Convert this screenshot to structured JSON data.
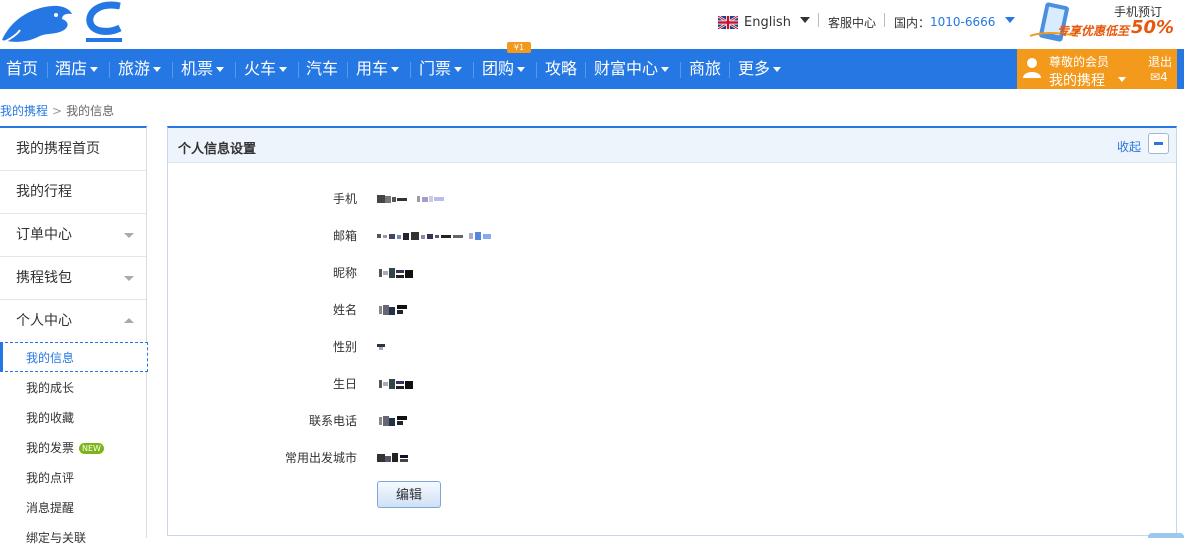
{
  "topbar": {
    "language": "English",
    "service_center": "客服中心",
    "domestic_label": "国内：",
    "phone": "1010-6666",
    "promo_title": "手机预订",
    "promo_sub": "专享优惠低至",
    "promo_pct": "50%"
  },
  "nav": {
    "items": [
      "首页",
      "酒店",
      "旅游",
      "机票",
      "火车",
      "汽车",
      "用车",
      "门票",
      "团购",
      "攻略",
      "财富中心",
      "商旅",
      "更多"
    ],
    "groupbuy_badge": "¥1"
  },
  "member": {
    "greeting": "尊敬的会员",
    "my_ctrip": "我的携程",
    "logout": "退出",
    "mail_count": "4"
  },
  "breadcrumb": {
    "root": "我的携程",
    "separator": ">",
    "current": "我的信息"
  },
  "sidebar": {
    "items": [
      "我的携程首页",
      "我的行程",
      "订单中心",
      "携程钱包",
      "个人中心"
    ],
    "sub_items": [
      "我的信息",
      "我的成长",
      "我的收藏",
      "我的发票",
      "我的点评",
      "消息提醒",
      "绑定与关联"
    ],
    "new_badge": "NEW"
  },
  "panel": {
    "title": "个人信息设置",
    "collapse": "收起",
    "fields": [
      "手机",
      "邮箱",
      "昵称",
      "姓名",
      "性别",
      "生日",
      "联系电话",
      "常用出发城市"
    ],
    "edit_button": "编辑"
  },
  "colors": {
    "brand_blue": "#2577e3",
    "member_orange": "#f39a1d",
    "new_green": "#7cb518"
  }
}
